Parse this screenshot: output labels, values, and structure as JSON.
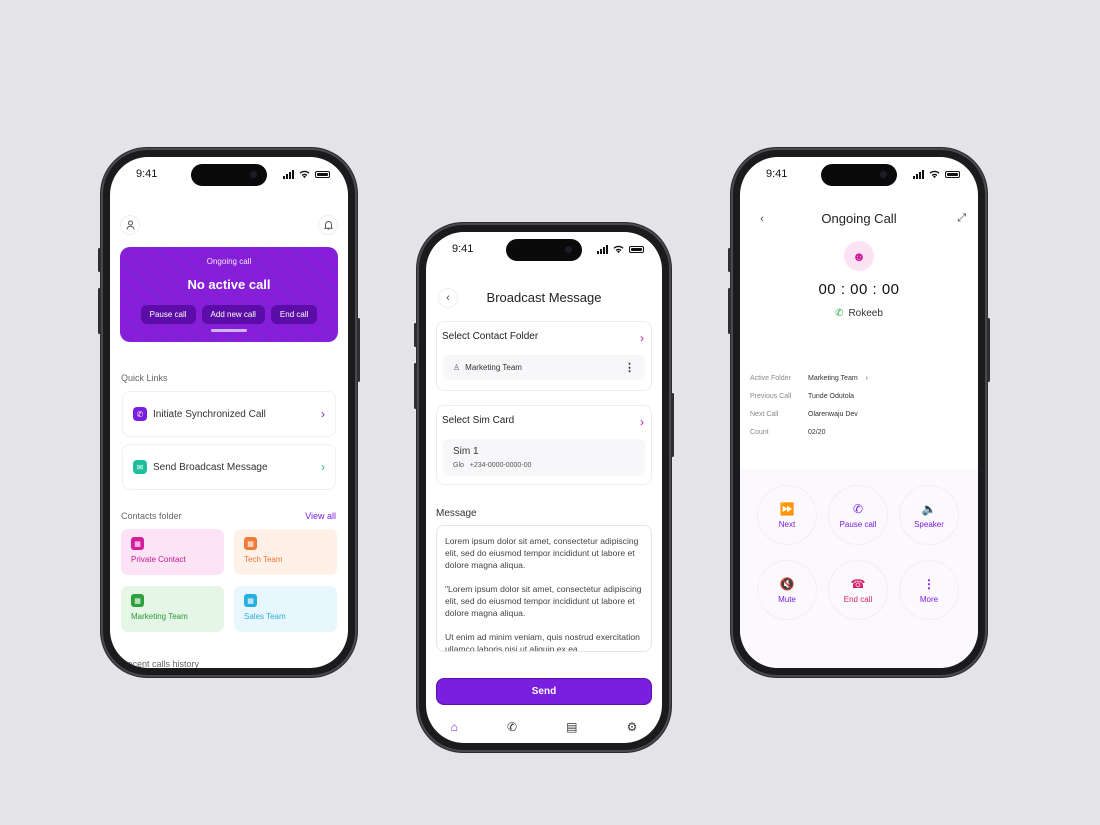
{
  "status_time": "9:41",
  "icons": {
    "user": "user-icon",
    "bell": "bell-icon",
    "back": "chevron-left-icon",
    "chevron": "chevron-right-icon",
    "more": "more-vertical-icon"
  },
  "colors": {
    "primary": "#7a1ee0",
    "magenta": "#b01ea8",
    "teal": "#1dbf9a",
    "green": "#2ca94a"
  },
  "home": {
    "ongoing_label": "Ongoing call",
    "ongoing_title": "No active call",
    "buttons": [
      "Pause call",
      "Add new call",
      "End call"
    ],
    "quick_links_title": "Quick Links",
    "quick_links": [
      "Initiate Synchronized Call",
      "Send Broadcast Message"
    ],
    "contacts_title": "Contacts folder",
    "view_all": "View all",
    "folders": [
      "Private Contact",
      "Tech Team",
      "Marketing Team",
      "Sales Team"
    ],
    "recent_title": "Recent calls history"
  },
  "broadcast": {
    "title": "Broadcast Message",
    "folder_label": "Select Contact Folder",
    "folder_value": "Marketing Team",
    "sim_label": "Select Sim Card",
    "sim_name": "Sim 1",
    "sim_carrier": "Glo",
    "sim_number": "+234-0000-0000-00",
    "message_label": "Message",
    "message_paragraphs": [
      "Lorem ipsum dolor sit amet, consectetur adipiscing elit, sed do eiusmod tempor incididunt ut labore et dolore magna aliqua.",
      "\"Lorem ipsum dolor sit amet, consectetur adipiscing elit, sed do eiusmod tempor incididunt ut labore et dolore magna aliqua.",
      "Ut enim ad minim veniam, quis nostrud exercitation ullamco laboris nisi ut aliquip ex ea"
    ],
    "send_label": "Send"
  },
  "ongoing": {
    "title": "Ongoing Call",
    "timer": "00 : 00 : 00",
    "caller": "Rokeeb",
    "info": [
      {
        "k": "Active Folder",
        "v": "Marketing Team"
      },
      {
        "k": "Previous Call",
        "v": "Tunde Odutola"
      },
      {
        "k": "Next Call",
        "v": "Olarenwaju Dev"
      },
      {
        "k": "Count",
        "v": "02/20"
      }
    ],
    "controls": [
      "Next",
      "Pause call",
      "Speaker",
      "Mute",
      "End call",
      "More"
    ]
  }
}
